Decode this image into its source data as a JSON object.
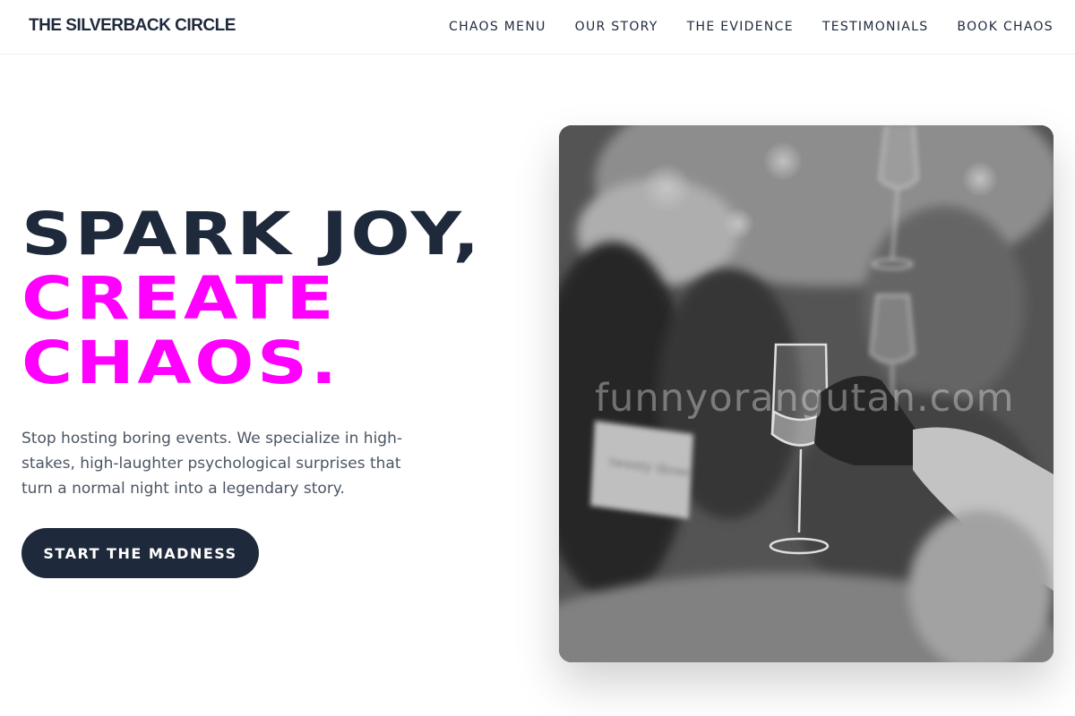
{
  "header": {
    "logo": "THE SILVERBACK CIRCLE",
    "nav": [
      {
        "label": "CHAOS MENU"
      },
      {
        "label": "OUR STORY"
      },
      {
        "label": "THE EVIDENCE"
      },
      {
        "label": "TESTIMONIALS"
      },
      {
        "label": "BOOK CHAOS"
      }
    ]
  },
  "hero": {
    "headline_line1": "SPARK JOY,",
    "headline_line2": "CREATE",
    "headline_line3": "CHAOS.",
    "subtext": "Stop hosting boring events. We specialize in high-stakes, high-laughter psychological surprises that turn a normal night into a legendary story.",
    "cta_label": "START THE MADNESS",
    "image": {
      "description_icon": "party-toast-photo",
      "watermark": "funnyorangutan.com",
      "table_card_text": "twenty three"
    }
  },
  "colors": {
    "primary_dark": "#1e293b",
    "accent": "#ff00ff",
    "body_text": "#4b5563",
    "background": "#ffffff"
  }
}
